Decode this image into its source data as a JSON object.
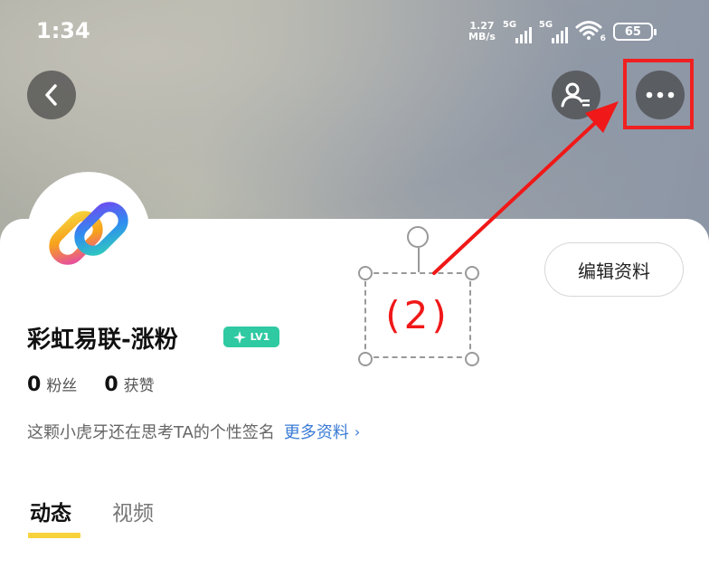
{
  "status_bar": {
    "time": "1:34",
    "net_speed_value": "1.27",
    "net_speed_unit": "MB/s",
    "signal_1_label": "5G",
    "signal_2_label": "5G",
    "wifi_label": "6",
    "battery": "65",
    "icons": [
      "signal-icon",
      "wifi-icon",
      "battery-icon"
    ]
  },
  "nav": {
    "icons": [
      "back-arrow-icon",
      "user-list-icon",
      "more-dots-icon"
    ]
  },
  "profile": {
    "name": "彩虹易联-涨粉",
    "level": "LV1",
    "followers_count": "0",
    "followers_label": "粉丝",
    "likes_count": "0",
    "likes_label": "获赞",
    "bio": "这颗小虎牙还在思考TA的个性签名",
    "more_info": "更多资料",
    "edit_button": "编辑资料"
  },
  "tabs": [
    {
      "label": "动态",
      "active": true
    },
    {
      "label": "视频",
      "active": false
    }
  ],
  "annotation": {
    "label": "(2)",
    "color": "#f01818"
  },
  "colors": {
    "accent_tab": "#f7d23b",
    "level_badge": "#2fc9a2",
    "link": "#3a7bd5",
    "highlight": "#f02020"
  }
}
